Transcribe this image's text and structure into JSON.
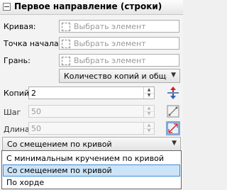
{
  "header": {
    "title": "Первое направление (строки)"
  },
  "fields": {
    "curve": {
      "label": "Кривая:",
      "placeholder": "Выбрать элемент"
    },
    "start_point": {
      "label": "Точка начала:",
      "placeholder": "Выбрать элемент"
    },
    "edge": {
      "label": "Грань:",
      "placeholder": "Выбрать элемент"
    }
  },
  "mode_combo": {
    "value": "Количество копий и общая д"
  },
  "params": {
    "copies": {
      "label": "Копий",
      "value": "2",
      "enabled": true
    },
    "step": {
      "label": "Шаг",
      "value": "50",
      "enabled": false
    },
    "length": {
      "label": "Длина",
      "value": "50",
      "enabled": false
    }
  },
  "orientation_combo": {
    "value": "Со смещением по кривой",
    "options": [
      "С минимальным кручением по кривой",
      "Со смещением по кривой",
      "По хорде"
    ],
    "selected_index": 1
  },
  "icons": {
    "collapse": "collapse-minus-icon",
    "swap_direction": "reverse-direction-icon",
    "step_mode": "step-measure-icon",
    "length_mode": "length-measure-icon",
    "accent": "#d42020"
  }
}
